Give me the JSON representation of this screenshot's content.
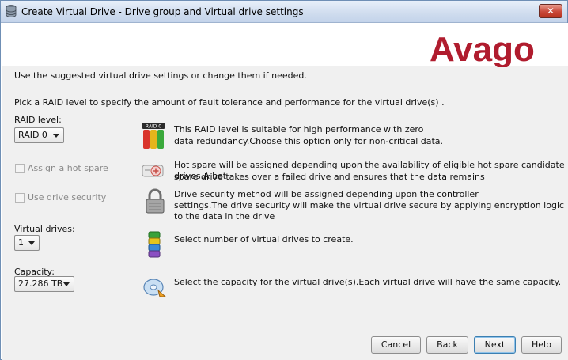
{
  "window": {
    "title": "Create Virtual Drive - Drive group and Virtual drive settings",
    "close_label": "✕"
  },
  "brand": {
    "name": "Avago",
    "color": "#b01c2e"
  },
  "intro": {
    "line1": "Use the suggested virtual drive settings or change them if needed.",
    "line2": "Pick a RAID level to specify the amount of fault tolerance and performance for the virtual drive(s) ."
  },
  "raid": {
    "label": "RAID level:",
    "value": "RAID  0",
    "desc_line1": "This RAID level is suitable for high performance with zero",
    "desc_line2": "data redundancy.Choose this option only for non-critical data.",
    "icon_badge": "RAID 0"
  },
  "hot_spare": {
    "label": "Assign a hot spare",
    "checked": false,
    "desc_line1": "Hot spare will be assigned depending upon the availability of eligible hot spare candidate drives.A hot",
    "desc_line2": "spare drive takes over a failed drive and ensures that the data remains"
  },
  "security": {
    "label": "Use drive security",
    "checked": false,
    "desc_line1": "Drive security method will be assigned depending upon the controller",
    "desc_line2": "settings.The drive security will make the virtual drive secure by applying encryption logic",
    "desc_line3": "to the data in the drive"
  },
  "virtual_drives": {
    "label": "Virtual drives:",
    "value": "1",
    "desc": "Select number of virtual drives to create."
  },
  "capacity": {
    "label": "Capacity:",
    "value": "27.286 TB",
    "desc": "Select the capacity for the virtual drive(s).Each virtual drive will have the same capacity."
  },
  "buttons": {
    "cancel": "Cancel",
    "back": "Back",
    "next": "Next",
    "help": "Help"
  }
}
